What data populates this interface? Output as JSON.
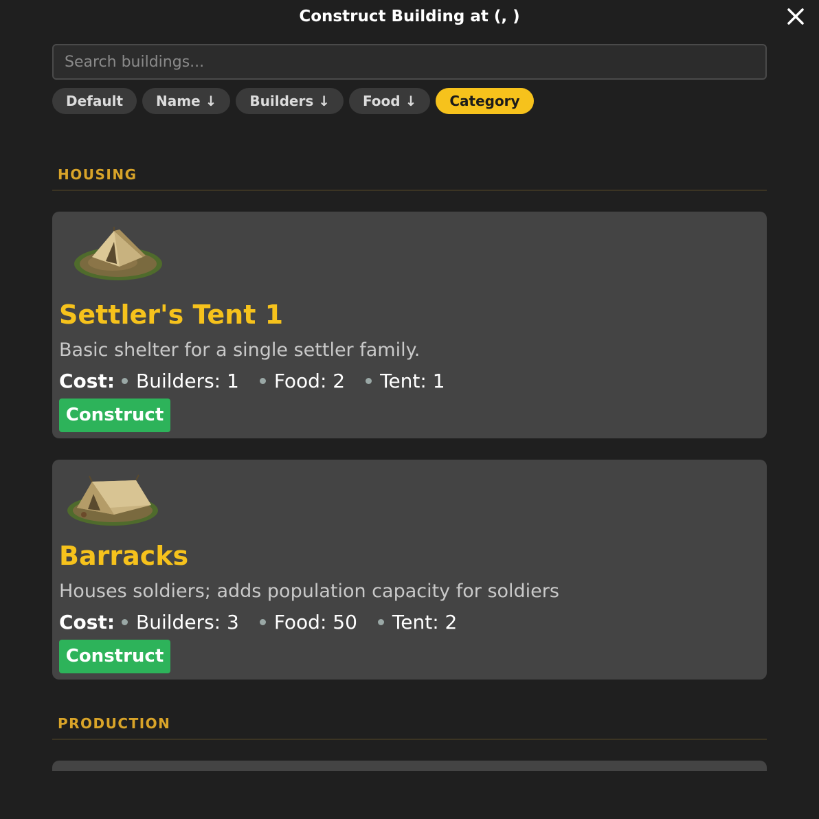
{
  "modal": {
    "title": "Construct Building at (, )"
  },
  "search": {
    "placeholder": "Search buildings..."
  },
  "sort": {
    "options": [
      "Default",
      "Name ↓",
      "Builders ↓",
      "Food ↓",
      "Category"
    ],
    "active": "Category"
  },
  "categories": [
    {
      "heading": "HOUSING",
      "buildings": [
        {
          "name": "Settler's Tent 1",
          "description": "Basic shelter for a single settler family.",
          "cost_label": "Cost:",
          "costs": [
            "Builders: 1",
            "Food: 2",
            "Tent: 1"
          ],
          "action": "Construct",
          "icon": "small-tent-icon"
        },
        {
          "name": "Barracks",
          "description": "Houses soldiers; adds population capacity for soldiers",
          "cost_label": "Cost:",
          "costs": [
            "Builders: 3",
            "Food: 50",
            "Tent: 2"
          ],
          "action": "Construct",
          "icon": "large-tent-icon"
        }
      ]
    },
    {
      "heading": "PRODUCTION",
      "buildings": []
    }
  ],
  "colors": {
    "accent": "#f6c21c",
    "construct": "#2db35a",
    "heading": "#d9a429"
  }
}
